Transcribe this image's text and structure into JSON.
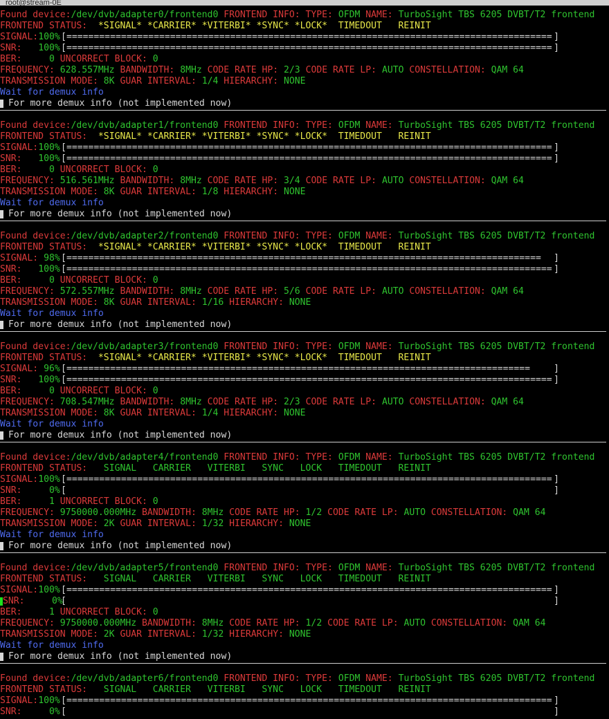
{
  "window": {
    "title": "root@stream-0E"
  },
  "labels": {
    "found": "Found device:",
    "frontend_info": "FRONTEND INFO:",
    "type_label": "TYPE:",
    "name_label": "NAME:",
    "status_label": "FRONTEND STATUS:",
    "signal_label": "SIGNAL:",
    "snr_label": "SNR:",
    "ber_label": "BER:",
    "uncorrect_label": "UNCORRECT BLOCK:",
    "freq_label": "FREQUENCY:",
    "bw_label": "BANDWIDTH:",
    "cr_hp_label": "CODE RATE HP:",
    "cr_lp_label": "CODE RATE LP:",
    "constellation_label": "CONSTELLATION:",
    "tm_label": "TRANSMISSION MODE:",
    "guard_label": "GUAR INTERVAL:",
    "hier_label": "HIERARCHY:",
    "wait_demux": "Wait for demux info",
    "more_demux": "For more demux info (not implemented now)"
  },
  "devices": [
    {
      "path": "/dev/dvb/adapter0/frontend0",
      "type": "OFDM",
      "name": "TurboSight TBS 6205 DVBT/T2 frontend",
      "status": "*SIGNAL* *CARRIER* *VITERBI* *SYNC* *LOCK*  TIMEDOUT   REINIT",
      "locked": true,
      "signal_pct": "100%",
      "signal_level": 1.0,
      "snr_pct": "100%",
      "snr_level": 1.0,
      "ber": "0",
      "uncorrect": "0",
      "frequency": "628.557MHz",
      "bandwidth": "8MHz",
      "cr_hp": "2/3",
      "cr_lp": "AUTO",
      "constellation": "QAM 64",
      "tm": "8K",
      "guard": "1/4",
      "hierarchy": "NONE"
    },
    {
      "path": "/dev/dvb/adapter1/frontend0",
      "type": "OFDM",
      "name": "TurboSight TBS 6205 DVBT/T2 frontend",
      "status": "*SIGNAL* *CARRIER* *VITERBI* *SYNC* *LOCK*  TIMEDOUT   REINIT",
      "locked": true,
      "signal_pct": "100%",
      "signal_level": 1.0,
      "snr_pct": "100%",
      "snr_level": 1.0,
      "ber": "0",
      "uncorrect": "0",
      "frequency": "516.561MHz",
      "bandwidth": "8MHz",
      "cr_hp": "3/4",
      "cr_lp": "AUTO",
      "constellation": "QAM 64",
      "tm": "8K",
      "guard": "1/8",
      "hierarchy": "NONE"
    },
    {
      "path": "/dev/dvb/adapter2/frontend0",
      "type": "OFDM",
      "name": "TurboSight TBS 6205 DVBT/T2 frontend",
      "status": "*SIGNAL* *CARRIER* *VITERBI* *SYNC* *LOCK*  TIMEDOUT   REINIT",
      "locked": true,
      "signal_pct": " 98%",
      "signal_level": 0.98,
      "snr_pct": "100%",
      "snr_level": 1.0,
      "ber": "0",
      "uncorrect": "0",
      "frequency": "572.557MHz",
      "bandwidth": "8MHz",
      "cr_hp": "5/6",
      "cr_lp": "AUTO",
      "constellation": "QAM 64",
      "tm": "8K",
      "guard": "1/16",
      "hierarchy": "NONE"
    },
    {
      "path": "/dev/dvb/adapter3/frontend0",
      "type": "OFDM",
      "name": "TurboSight TBS 6205 DVBT/T2 frontend",
      "status": "*SIGNAL* *CARRIER* *VITERBI* *SYNC* *LOCK*  TIMEDOUT   REINIT",
      "locked": true,
      "signal_pct": " 96%",
      "signal_level": 0.96,
      "snr_pct": "100%",
      "snr_level": 1.0,
      "ber": "0",
      "uncorrect": "0",
      "frequency": "708.547MHz",
      "bandwidth": "8MHz",
      "cr_hp": "2/3",
      "cr_lp": "AUTO",
      "constellation": "QAM 64",
      "tm": "8K",
      "guard": "1/4",
      "hierarchy": "NONE"
    },
    {
      "path": "/dev/dvb/adapter4/frontend0",
      "type": "OFDM",
      "name": "TurboSight TBS 6205 DVBT/T2 frontend",
      "status": " SIGNAL   CARRIER   VITERBI   SYNC   LOCK   TIMEDOUT   REINIT",
      "locked": false,
      "signal_pct": "100%",
      "signal_level": 1.0,
      "snr_pct": "  0%",
      "snr_level": 0,
      "ber": "1",
      "uncorrect": "0",
      "frequency": "9750000.000MHz",
      "bandwidth": "8MHz",
      "cr_hp": "1/2",
      "cr_lp": "AUTO",
      "constellation": "QAM 64",
      "tm": "2K",
      "guard": "1/32",
      "hierarchy": "NONE"
    },
    {
      "path": "/dev/dvb/adapter5/frontend0",
      "type": "OFDM",
      "name": "TurboSight TBS 6205 DVBT/T2 frontend",
      "status": " SIGNAL   CARRIER   VITERBI   SYNC   LOCK   TIMEDOUT   REINIT",
      "locked": false,
      "signal_pct": "100%",
      "signal_level": 1.0,
      "snr_pct": "  0%",
      "snr_level": 0,
      "ber": "1",
      "uncorrect": "0",
      "frequency": "9750000.000MHz",
      "bandwidth": "8MHz",
      "cr_hp": "1/2",
      "cr_lp": "AUTO",
      "constellation": "QAM 64",
      "tm": "2K",
      "guard": "1/32",
      "hierarchy": "NONE",
      "green_cursor": true
    },
    {
      "path": "/dev/dvb/adapter6/frontend0",
      "type": "OFDM",
      "name": "TurboSight TBS 6205 DVBT/T2 frontend",
      "status": " SIGNAL   CARRIER   VITERBI   SYNC   LOCK   TIMEDOUT   REINIT",
      "locked": false,
      "signal_pct": "100%",
      "signal_level": 1.0,
      "snr_pct": "  0%",
      "snr_level": 0,
      "partial": true
    }
  ],
  "colors": {
    "red": "#dc3a3a",
    "green": "#2fc42f",
    "yellow": "#e8e84a",
    "blue": "#4f6bf0",
    "white": "#d8d8d8"
  }
}
